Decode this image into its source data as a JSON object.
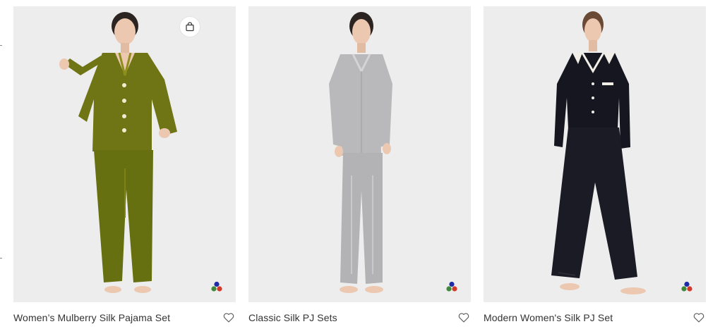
{
  "products": [
    {
      "name": "Women’s Mulberry Silk Pajama Set",
      "image_label": "olive green silk pajama set",
      "color": "#6f7415",
      "accent": "#8d8f1c",
      "skin": "#ecc8b0",
      "has_bag_button": true
    },
    {
      "name": "Classic Silk PJ Sets",
      "image_label": "silver grey silk pajama set",
      "color": "#b9b9bb",
      "accent": "#d4d4d6",
      "skin": "#ecc8b0",
      "has_bag_button": false
    },
    {
      "name": "Modern Women's Silk PJ Set",
      "image_label": "black silk pajama set with white piping",
      "color": "#15161f",
      "accent": "#2a2b36",
      "skin": "#ecc8b0",
      "has_bag_button": false
    }
  ],
  "icons": {
    "bag": "shopping-bag-icon",
    "heart": "heart-outline-icon",
    "swatch": "color-swatch-icon"
  },
  "colors": {
    "card_background": "#ededed",
    "text": "#333333",
    "swatch_red": "#d23a2a",
    "swatch_green": "#3f8a3a",
    "swatch_blue": "#1f2aa6"
  }
}
